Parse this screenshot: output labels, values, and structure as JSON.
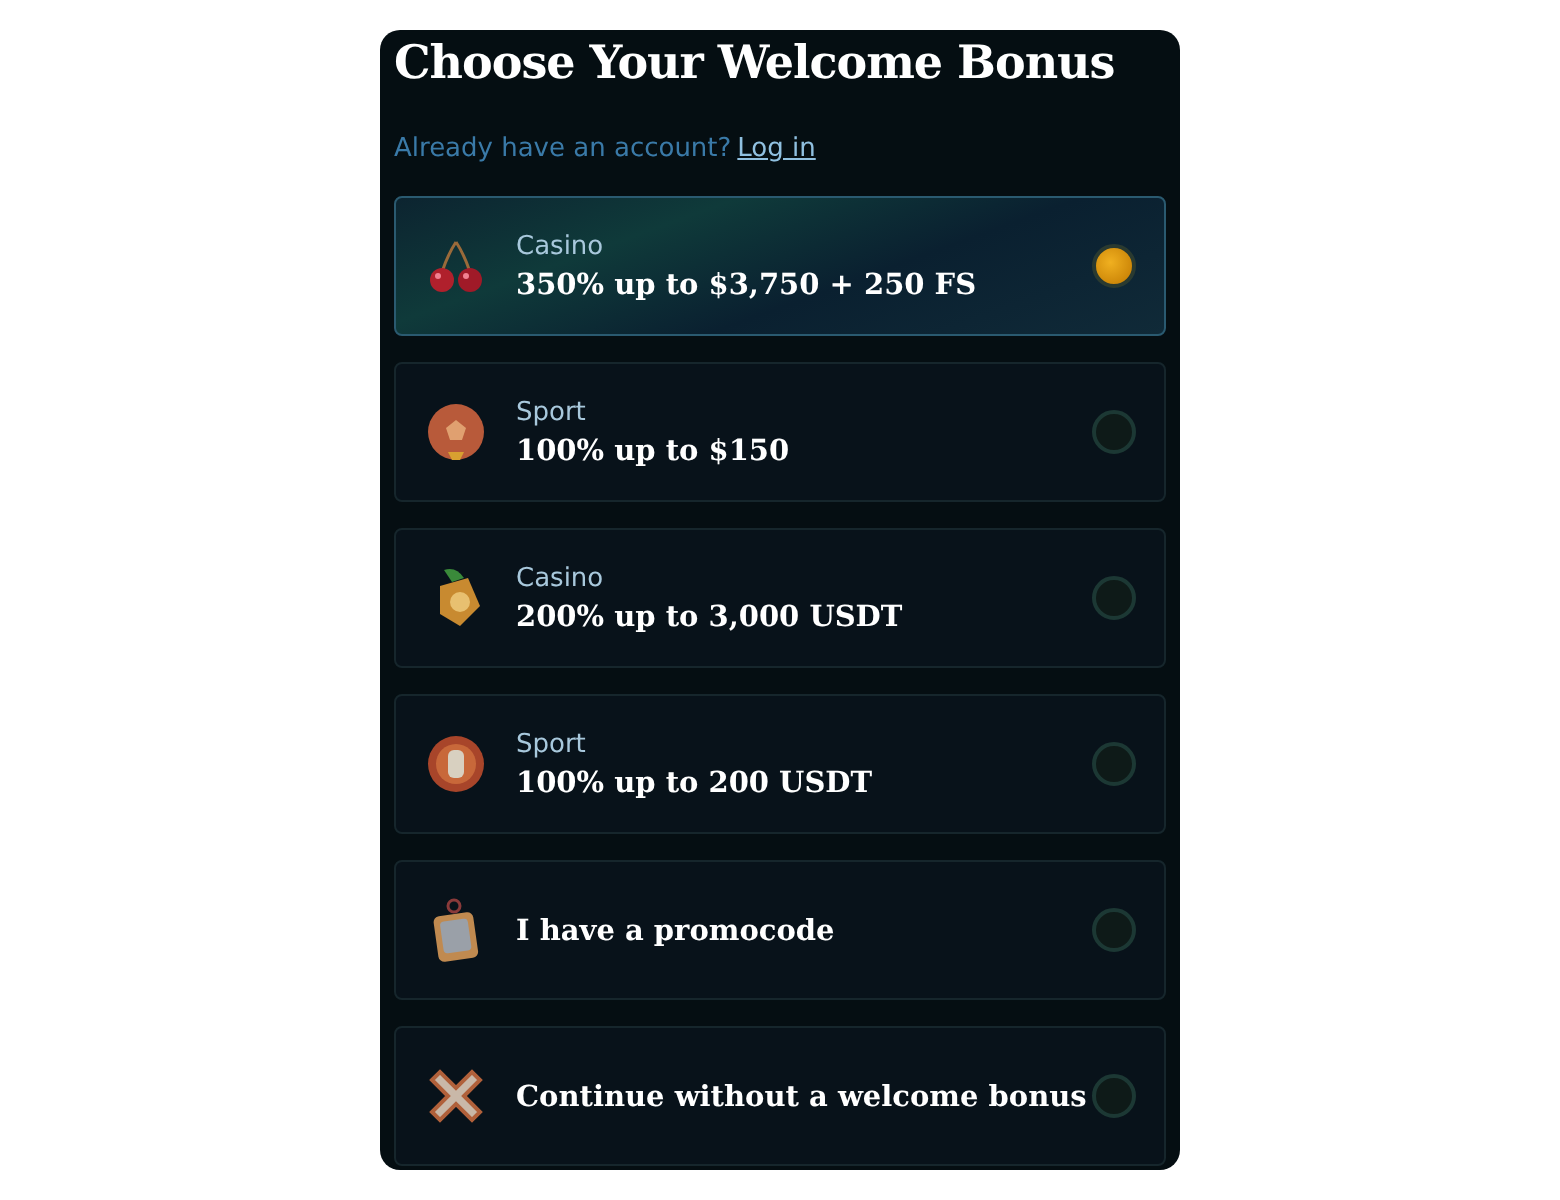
{
  "title": "Choose Your Welcome Bonus",
  "account_prompt": {
    "text": "Already have an account?",
    "link": "Log in"
  },
  "options": [
    {
      "category": "Casino",
      "offer": "350% up to $3,750 + 250 FS",
      "selected": true
    },
    {
      "category": "Sport",
      "offer": "100% up to $150",
      "selected": false
    },
    {
      "category": "Casino",
      "offer": "200% up to 3,000 USDT",
      "selected": false
    },
    {
      "category": "Sport",
      "offer": "100% up to 200 USDT",
      "selected": false
    },
    {
      "offer": "I have a promocode",
      "selected": false
    },
    {
      "offer": "Continue without a welcome bonus",
      "selected": false
    }
  ]
}
